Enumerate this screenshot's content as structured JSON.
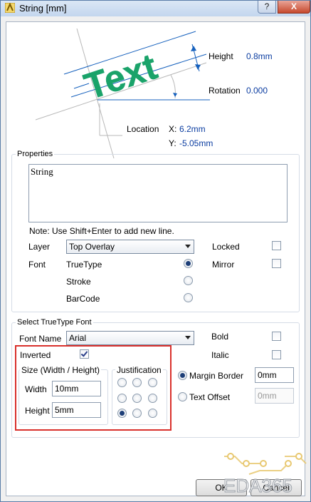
{
  "window": {
    "title": "String  [mm]",
    "help_label": "?",
    "close_label": "X"
  },
  "diagram": {
    "sample_text": "Text",
    "height_label": "Height",
    "height_value": "0.8mm",
    "rotation_label": "Rotation",
    "rotation_value": "0.000",
    "location_label": "Location",
    "x_label": "X:",
    "x_value": "6.2mm",
    "y_label": "Y:",
    "y_value": "-5.05mm"
  },
  "properties": {
    "title": "Properties",
    "text_value": "String",
    "note": "Note: Use Shift+Enter to add new line.",
    "layer_label": "Layer",
    "layer_value": "Top Overlay",
    "locked_label": "Locked",
    "locked_checked": false,
    "font_label": "Font",
    "font_options": [
      "TrueType",
      "Stroke",
      "BarCode"
    ],
    "font_selected": "TrueType",
    "mirror_label": "Mirror",
    "mirror_checked": false
  },
  "truetype": {
    "title": "Select TrueType Font",
    "font_name_label": "Font Name",
    "font_name_value": "Arial",
    "bold_label": "Bold",
    "bold_checked": false,
    "italic_label": "Italic",
    "italic_checked": false,
    "inverted_label": "Inverted",
    "inverted_checked": true,
    "size_title": "Size (Width / Height)",
    "width_label": "Width",
    "width_value": "10mm",
    "height_label": "Height",
    "height_value": "5mm",
    "justification_title": "Justification",
    "justification_selected": "bottom-left",
    "margin_border_label": "Margin Border",
    "margin_border_value": "0mm",
    "margin_border_selected": true,
    "text_offset_label": "Text Offset",
    "text_offset_value": "0mm"
  },
  "buttons": {
    "ok_label": "OK",
    "cancel_label": "Cancel"
  },
  "watermark": {
    "text": "EDA365"
  },
  "colors": {
    "accent": "#1560bd",
    "sample_text": "#1aa36a",
    "highlight_box": "#d9302c"
  }
}
